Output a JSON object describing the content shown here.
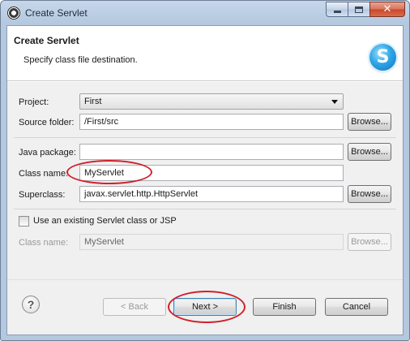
{
  "window": {
    "title": "Create Servlet"
  },
  "banner": {
    "title": "Create Servlet",
    "description": "Specify class file destination.",
    "logo_letter": "S"
  },
  "form": {
    "project": {
      "label": "Project:",
      "value": "First"
    },
    "source_folder": {
      "label": "Source folder:",
      "value": "/First/src",
      "browse": "Browse..."
    },
    "java_package": {
      "label": "Java package:",
      "value": "",
      "browse": "Browse..."
    },
    "class_name": {
      "label": "Class name:",
      "value": "MyServlet"
    },
    "superclass": {
      "label": "Superclass:",
      "value": "javax.servlet.http.HttpServlet",
      "browse": "Browse..."
    },
    "use_existing": {
      "label": "Use an existing Servlet class or JSP",
      "checked": false
    },
    "existing_class_name": {
      "label": "Class name:",
      "value": "MyServlet",
      "browse": "Browse...",
      "enabled": false
    }
  },
  "footer": {
    "help_glyph": "?",
    "back": "< Back",
    "next": "Next >",
    "finish": "Finish",
    "cancel": "Cancel"
  },
  "annotation_color": "#d0202a",
  "icons": [
    "app-icon",
    "minimize-icon",
    "maximize-icon",
    "close-icon",
    "servlet-logo-icon",
    "help-icon",
    "dropdown-arrow-icon"
  ]
}
